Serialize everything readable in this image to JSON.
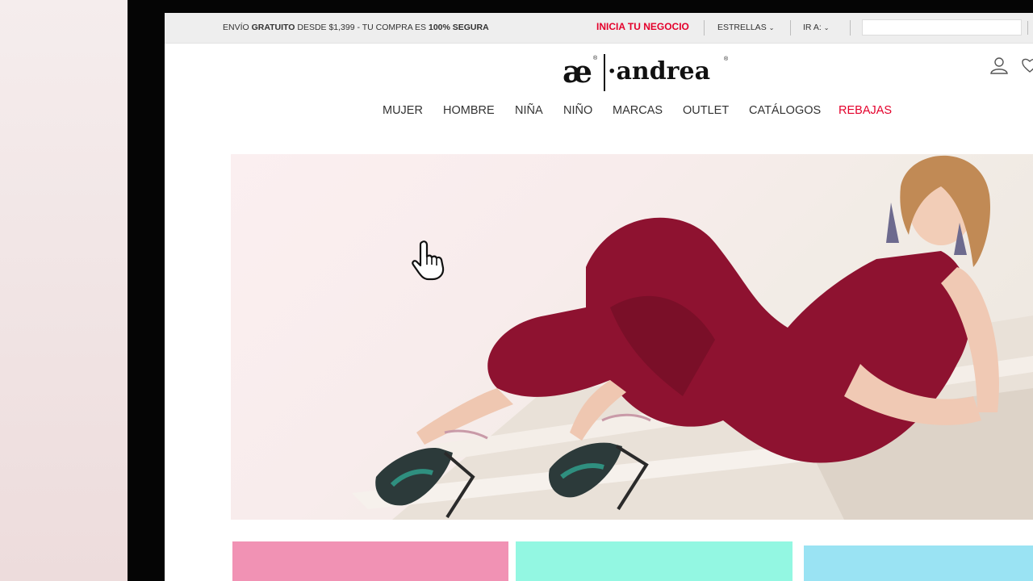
{
  "topbar": {
    "promo_prefix": "ENVÍO ",
    "promo_bold1": "GRATUITO",
    "promo_mid": " DESDE $1,399 - TU COMPRA ES ",
    "promo_bold2": "100% SEGURA",
    "business_link": "INICIA TU NEGOCIO",
    "stars_dropdown": "ESTRELLAS",
    "goto_dropdown": "IR A:",
    "search_placeholder": ""
  },
  "logo": {
    "mark": "æ",
    "wordmark": "·andrea",
    "registered": "®"
  },
  "nav": {
    "items": [
      "MUJER",
      "HOMBRE",
      "NIÑA",
      "NIÑO",
      "MARCAS",
      "OUTLET",
      "CATÁLOGOS",
      "REBAJAS"
    ]
  },
  "icons": {
    "user": "user-icon",
    "wishlist": "heart-icon",
    "cursor": "hand-pointer-icon",
    "chevron": "chevron-down-icon"
  },
  "colors": {
    "accent_red": "#e4002b",
    "tile_pink": "#f192b4",
    "tile_mint": "#93f7e2",
    "tile_blue": "#9ae3f3",
    "outfit": "#8e1230"
  }
}
